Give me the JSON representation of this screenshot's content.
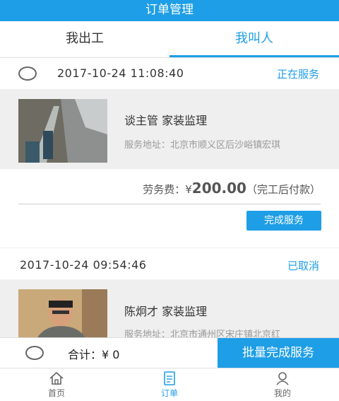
{
  "header": {
    "title": "订单管理"
  },
  "tabs": [
    {
      "label": "我出工"
    },
    {
      "label": "我叫人"
    }
  ],
  "orders": [
    {
      "datetime": "2017-10-24 11:08:40",
      "status": "正在服务",
      "person": "谈主管   家装监理",
      "address": "服务地址：北京市顺义区后沙峪镇宏琪",
      "fee_label": "劳务费：¥",
      "fee_amount": "200.00",
      "fee_note": "（完工后付款）",
      "action_label": "完成服务"
    },
    {
      "datetime": "2017-10-24 09:54:46",
      "status": "已取消",
      "person": "陈炯才  家装监理",
      "address": "服务地址：北京市通州区宋庄镇北京红"
    }
  ],
  "footer": {
    "total_label": "合计：¥ 0",
    "batch_button": "批量完成服务"
  },
  "nav": [
    {
      "label": "首页"
    },
    {
      "label": "订单"
    },
    {
      "label": "我的"
    }
  ],
  "colors": {
    "accent": "#1e9ee6"
  }
}
